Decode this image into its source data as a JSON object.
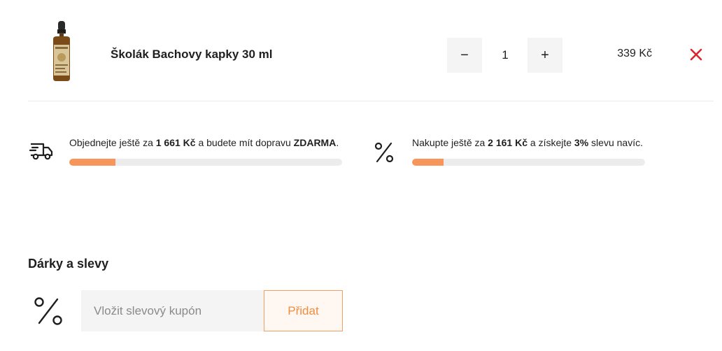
{
  "cart": {
    "item": {
      "name": "Školák Bachovy kapky 30 ml",
      "quantity": "1",
      "price": "339 Kč",
      "decrease_label": "−",
      "increase_label": "+",
      "remove_icon": "close-icon"
    }
  },
  "progress": {
    "shipping": {
      "icon": "truck-icon",
      "text_before": "Objednejte ještě za ",
      "amount": "1 661 Kč",
      "text_middle": " a budete mít dopravu ",
      "highlight": "ZDARMA",
      "text_after": ".",
      "progress_fraction": 0.17
    },
    "discount": {
      "icon": "percent-icon",
      "text_before": "Nakupte ještě za ",
      "amount": "2 161 Kč",
      "text_middle": " a získejte ",
      "highlight": "3%",
      "text_after": " slevu navíc.",
      "progress_fraction": 0.135
    }
  },
  "gifts": {
    "title": "Dárky a slevy",
    "coupon_placeholder": "Vložit slevový kupón",
    "coupon_value": "",
    "submit_label": "Přidat",
    "icon": "percent-icon"
  },
  "colors": {
    "accent": "#f7955a",
    "remove": "#d9262c",
    "track": "#ececec"
  }
}
